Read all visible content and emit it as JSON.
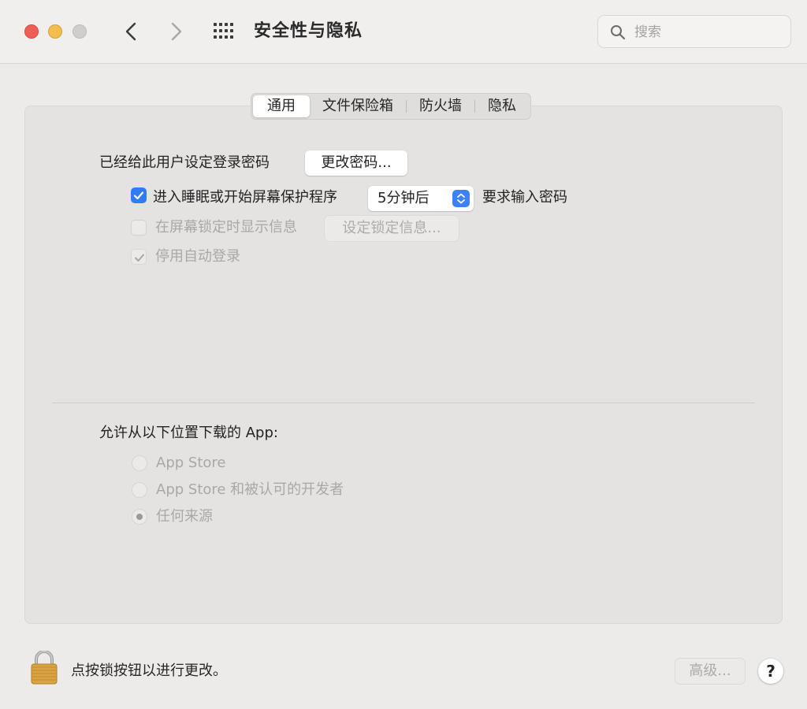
{
  "window": {
    "title": "安全性与隐私"
  },
  "search": {
    "placeholder": "搜索"
  },
  "tabs": [
    {
      "label": "通用",
      "active": true
    },
    {
      "label": "文件保险箱",
      "active": false
    },
    {
      "label": "防火墙",
      "active": false
    },
    {
      "label": "隐私",
      "active": false
    }
  ],
  "general": {
    "password_label": "已经给此用户设定登录密码",
    "change_password_button": "更改密码...",
    "require_password": {
      "checked": true,
      "label_before": "进入睡眠或开始屏幕保护程序",
      "delay_value": "5分钟后",
      "label_after": "要求输入密码"
    },
    "show_message": {
      "checked": false,
      "enabled": false,
      "label": "在屏幕锁定时显示信息",
      "button": "设定锁定信息..."
    },
    "disable_auto_login": {
      "checked": true,
      "enabled": false,
      "label": "停用自动登录"
    }
  },
  "downloads": {
    "heading": "允许从以下位置下载的 App:",
    "options": [
      {
        "label": "App Store",
        "selected": false
      },
      {
        "label": "App Store 和被认可的开发者",
        "selected": false
      },
      {
        "label": "任何来源",
        "selected": true
      }
    ]
  },
  "footer": {
    "lock_text": "点按锁按钮以进行更改。",
    "advanced_button": "高级...",
    "help_button": "?"
  },
  "colors": {
    "accent": "#2f7cf6",
    "close": "#ec5f57",
    "minimize": "#f3bd4f"
  }
}
